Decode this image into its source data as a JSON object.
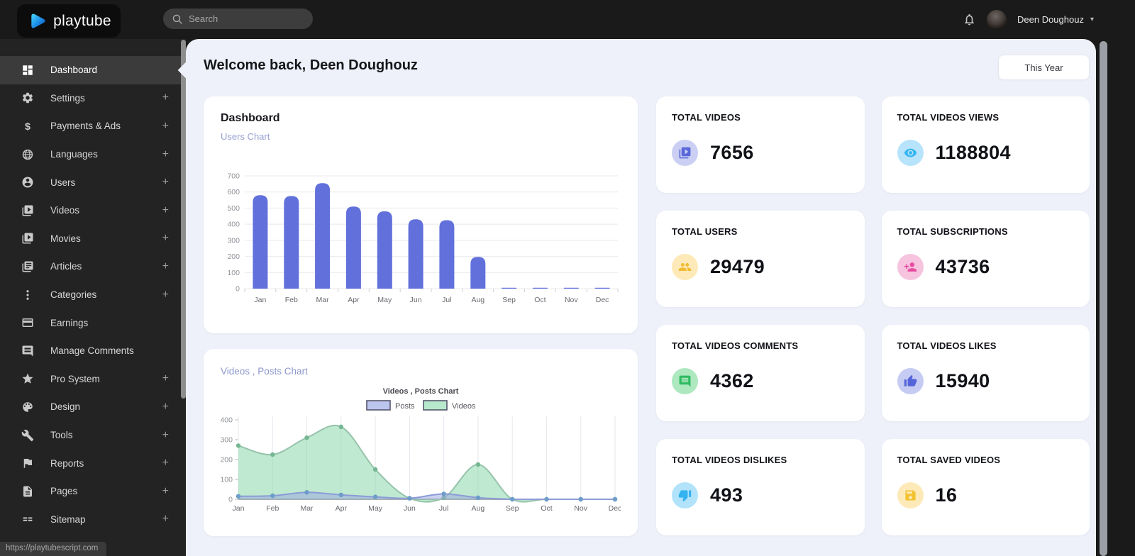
{
  "topbar": {
    "brand": "playtube",
    "search_placeholder": "Search",
    "user_name": "Deen Doughouz"
  },
  "sidebar": {
    "items": [
      {
        "label": "Dashboard",
        "icon": "dashboard-icon",
        "expandable": false,
        "active": true
      },
      {
        "label": "Settings",
        "icon": "gear-icon",
        "expandable": true,
        "active": false
      },
      {
        "label": "Payments & Ads",
        "icon": "dollar-icon",
        "expandable": true,
        "active": false
      },
      {
        "label": "Languages",
        "icon": "globe-icon",
        "expandable": true,
        "active": false
      },
      {
        "label": "Users",
        "icon": "user-icon",
        "expandable": true,
        "active": false
      },
      {
        "label": "Videos",
        "icon": "video-library-icon",
        "expandable": true,
        "active": false
      },
      {
        "label": "Movies",
        "icon": "video-library-icon",
        "expandable": true,
        "active": false
      },
      {
        "label": "Articles",
        "icon": "article-icon",
        "expandable": true,
        "active": false
      },
      {
        "label": "Categories",
        "icon": "dots-vertical-icon",
        "expandable": true,
        "active": false
      },
      {
        "label": "Earnings",
        "icon": "credit-card-icon",
        "expandable": false,
        "active": false
      },
      {
        "label": "Manage Comments",
        "icon": "comment-icon",
        "expandable": false,
        "active": false
      },
      {
        "label": "Pro System",
        "icon": "star-icon",
        "expandable": true,
        "active": false
      },
      {
        "label": "Design",
        "icon": "palette-icon",
        "expandable": true,
        "active": false
      },
      {
        "label": "Tools",
        "icon": "wrench-icon",
        "expandable": true,
        "active": false
      },
      {
        "label": "Reports",
        "icon": "flag-icon",
        "expandable": true,
        "active": false
      },
      {
        "label": "Pages",
        "icon": "page-icon",
        "expandable": true,
        "active": false
      },
      {
        "label": "Sitemap",
        "icon": "sitemap-icon",
        "expandable": true,
        "active": false
      }
    ],
    "status_url": "https://playtubescript.com"
  },
  "main": {
    "welcome_title": "Welcome back, Deen Doughouz",
    "period_button": "This Year"
  },
  "stats": [
    {
      "label": "TOTAL VIDEOS",
      "value": "7656",
      "icon": "video-library-icon",
      "icon_bg": "#cacff3",
      "icon_color": "#5967d9"
    },
    {
      "label": "TOTAL VIDEOS VIEWS",
      "value": "1188804",
      "icon": "eye-icon",
      "icon_bg": "#b7e4fb",
      "icon_color": "#32b4f1"
    },
    {
      "label": "TOTAL USERS",
      "value": "29479",
      "icon": "users-group-icon",
      "icon_bg": "#fdeab8",
      "icon_color": "#f0bc33"
    },
    {
      "label": "TOTAL SUBSCRIPTIONS",
      "value": "43736",
      "icon": "person-add-icon",
      "icon_bg": "#f6c4de",
      "icon_color": "#e74ba0"
    },
    {
      "label": "TOTAL VIDEOS COMMENTS",
      "value": "4362",
      "icon": "comment-icon",
      "icon_bg": "#ade8bf",
      "icon_color": "#2fba61"
    },
    {
      "label": "TOTAL VIDEOS LIKES",
      "value": "15940",
      "icon": "thumb-up-icon",
      "icon_bg": "#c5cbf2",
      "icon_color": "#5565d9"
    },
    {
      "label": "TOTAL VIDEOS DISLIKES",
      "value": "493",
      "icon": "thumb-down-icon",
      "icon_bg": "#b2e3fb",
      "icon_color": "#33b3f0"
    },
    {
      "label": "TOTAL SAVED VIDEOS",
      "value": "16",
      "icon": "save-icon",
      "icon_bg": "#fdeab8",
      "icon_color": "#f2c230"
    }
  ],
  "chart_data": [
    {
      "type": "bar",
      "card_title": "Dashboard",
      "subtitle": "Users Chart",
      "categories": [
        "Jan",
        "Feb",
        "Mar",
        "Apr",
        "May",
        "Jun",
        "Jul",
        "Aug",
        "Sep",
        "Oct",
        "Nov",
        "Dec"
      ],
      "values": [
        580,
        575,
        655,
        510,
        480,
        430,
        425,
        197,
        3,
        3,
        3,
        3
      ],
      "ylabel": "",
      "xlabel": "",
      "ylim": [
        0,
        700
      ],
      "yticks": [
        0,
        100,
        200,
        300,
        400,
        500,
        600,
        700
      ],
      "bar_color": "#6170db",
      "grid": true
    },
    {
      "type": "area",
      "card_title": "Videos , Posts Chart",
      "chart_title": "Videos , Posts Chart",
      "categories": [
        "Jan",
        "Feb",
        "Mar",
        "Apr",
        "May",
        "Jun",
        "Jul",
        "Aug",
        "Sep",
        "Oct",
        "Nov",
        "Dec"
      ],
      "series": [
        {
          "name": "Posts",
          "values": [
            15,
            18,
            35,
            22,
            12,
            5,
            27,
            8,
            0,
            0,
            0,
            0
          ],
          "fill": "#97a6e0",
          "line": "#8c9bd8",
          "point": "#6d9cc9",
          "legend_fill": "#bcc5ee"
        },
        {
          "name": "Videos",
          "values": [
            270,
            225,
            310,
            365,
            150,
            5,
            8,
            175,
            0,
            0,
            0,
            0
          ],
          "fill": "#7fd3a2",
          "line": "#96c3ab",
          "point": "#74b792",
          "legend_fill": "#b7e9cd"
        }
      ],
      "ylim": [
        0,
        400
      ],
      "yticks": [
        0,
        100,
        200,
        300,
        400
      ],
      "legend_position": "top",
      "grid": true
    }
  ]
}
